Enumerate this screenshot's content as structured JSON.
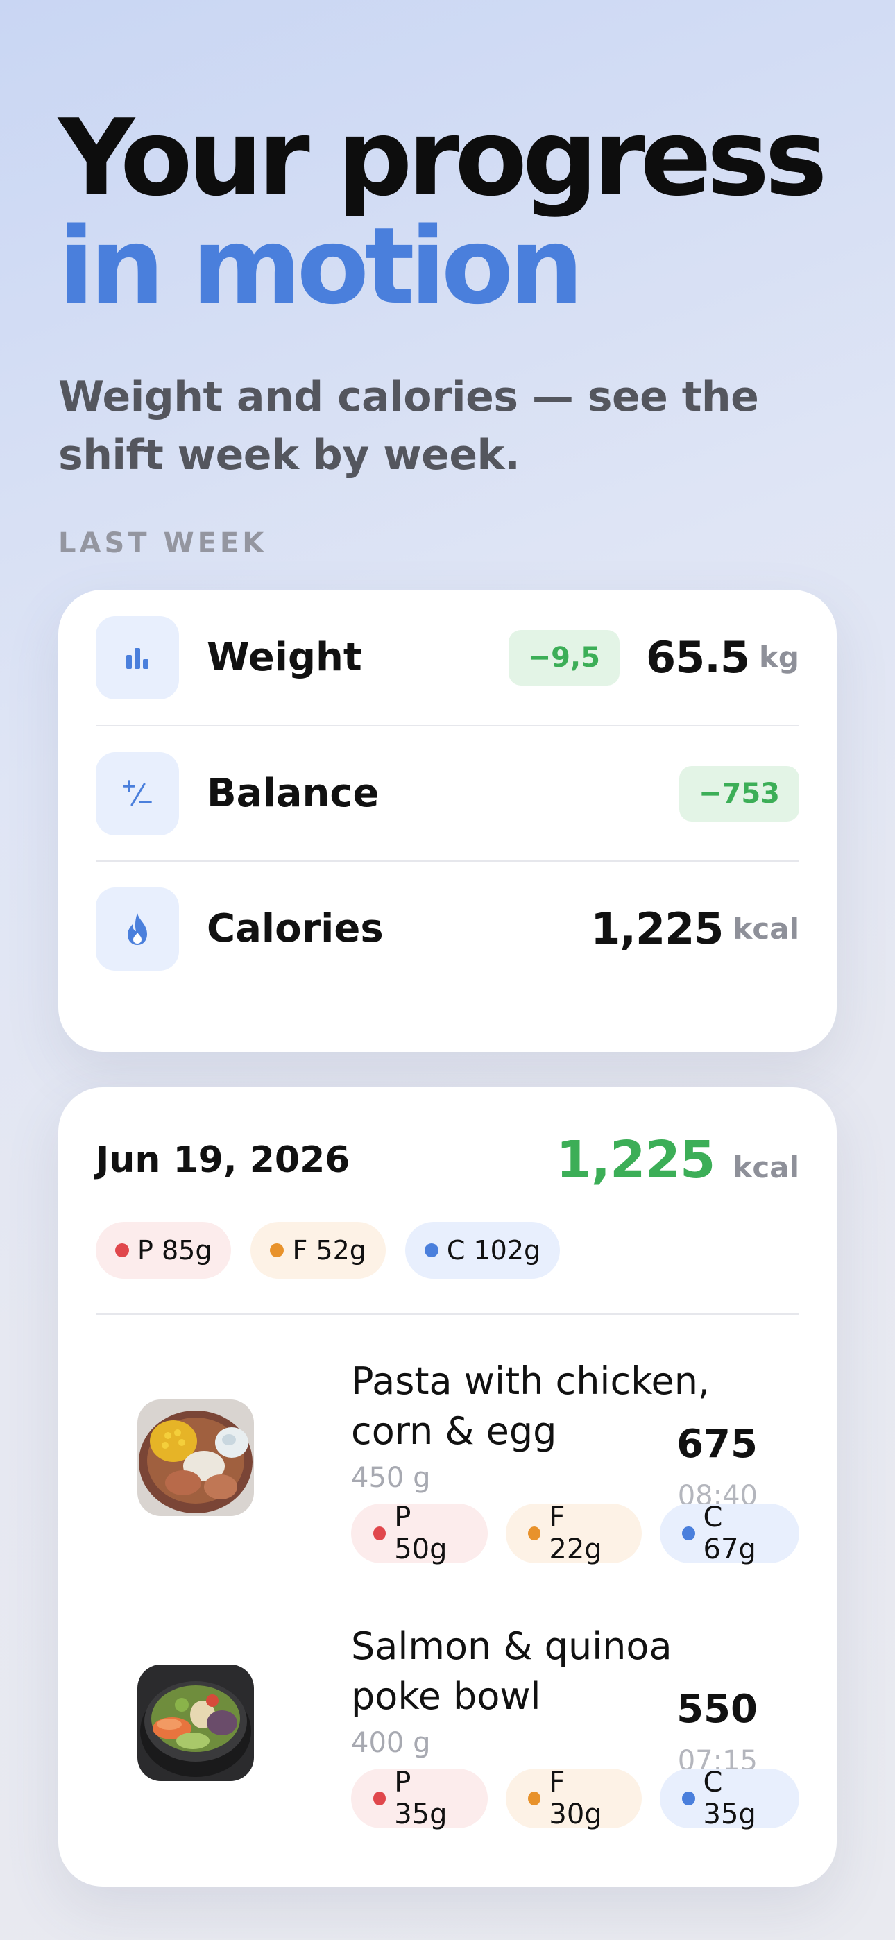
{
  "hero": {
    "title_line1": "Your progress",
    "title_line2": "in motion",
    "subtitle": "Weight and calories — see the shift week by week."
  },
  "summary": {
    "section_label": "LAST WEEK",
    "metrics": [
      {
        "icon": "bar-chart-icon",
        "label": "Weight",
        "delta": "−9,5",
        "value": "65.5",
        "unit": "kg"
      },
      {
        "icon": "plus-minus-icon",
        "label": "Balance",
        "delta": "−753",
        "value": "",
        "unit": ""
      },
      {
        "icon": "flame-icon",
        "label": "Calories",
        "delta": "",
        "value": "1,225",
        "unit": "kcal"
      }
    ]
  },
  "day": {
    "date": "Jun 19, 2026",
    "total_kcal": "1,225",
    "kcal_unit": "kcal",
    "macros": {
      "p": "P 85g",
      "f": "F 52g",
      "c": "C 102g"
    },
    "meals": [
      {
        "name": "Pasta with chicken, corn & egg",
        "weight": "450 g",
        "kcal": "675",
        "time": "08:40",
        "macros": {
          "p": "P 50g",
          "f": "F 22g",
          "c": "C 67g"
        }
      },
      {
        "name": "Salmon & quinoa poke bowl",
        "weight": "400 g",
        "kcal": "550",
        "time": "07:15",
        "macros": {
          "p": "P 35g",
          "f": "F 30g",
          "c": "C 35g"
        }
      }
    ]
  },
  "colors": {
    "accent_blue": "#4a7fdc",
    "positive_green": "#3cae57",
    "protein_red": "#e0474c",
    "fat_orange": "#e8922b",
    "carb_blue": "#4a7fdc"
  }
}
